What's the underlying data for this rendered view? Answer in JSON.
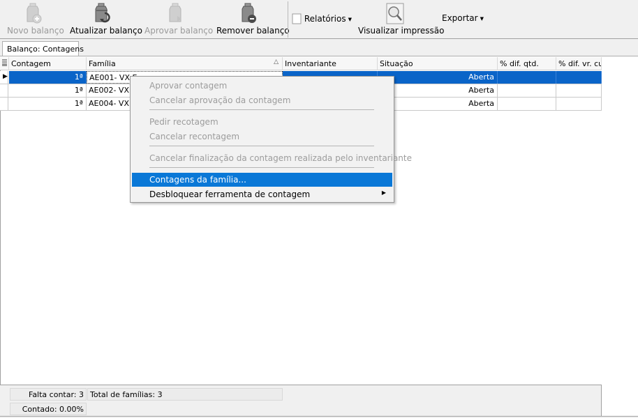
{
  "toolbar": {
    "new_balance": "Novo balanço",
    "update_balance": "Atualizar balanço",
    "approve_balance": "Aprovar balanço",
    "remove_balance": "Remover balanço",
    "reports": "Relatórios",
    "print_preview": "Visualizar impressão",
    "export": "Exportar"
  },
  "tab": {
    "label": "Balanço: Contagens"
  },
  "grid": {
    "columns": [
      "Contagem",
      "Família",
      "Inventariante",
      "Situação",
      "% dif. qtd.",
      "% dif. vr. cu"
    ],
    "rows": [
      {
        "contagem": "1ª",
        "familia": "AE001- VX E",
        "situacao": "Aberta"
      },
      {
        "contagem": "1ª",
        "familia": "AE002- VX E",
        "situacao": "Aberta"
      },
      {
        "contagem": "1ª",
        "familia": "AE004- VX E",
        "situacao": "Aberta"
      }
    ]
  },
  "footer": {
    "remaining": "Falta contar: 3",
    "total": "Total de famílias: 3",
    "counted": "Contado: 0.00%"
  },
  "context_menu": {
    "items": [
      "Aprovar contagem",
      "Cancelar aprovação da contagem",
      "Pedir recotagem",
      "Cancelar recontagem",
      "Cancelar finalização da contagem realizada pelo inventariante",
      "Contagens da família...",
      "Desbloquear ferramenta de contagem"
    ]
  },
  "colors": {
    "selection": "#0a64c8",
    "menu_highlight": "#0a78d7"
  }
}
